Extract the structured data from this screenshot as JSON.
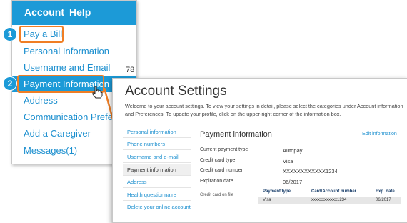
{
  "menu": {
    "bar": {
      "account_label": "Account",
      "help_label": "Help"
    },
    "items": [
      {
        "label": "Pay a Bill"
      },
      {
        "label": "Personal Information"
      },
      {
        "label": "Username and Email"
      },
      {
        "label": "Payment Information"
      },
      {
        "label": "Address"
      },
      {
        "label": "Communication Preferences"
      },
      {
        "label": "Add a Caregiver"
      },
      {
        "label": "Messages(1)"
      }
    ],
    "behind_text": {
      "number": "78"
    }
  },
  "steps": [
    {
      "number": "1"
    },
    {
      "number": "2"
    }
  ],
  "settings": {
    "title": "Account Settings",
    "description": "Welcome to your account settings. To view your settings in detail, please select the categories under Account information and Preferences. To update your profile, click on the upper-right corner of the information box.",
    "nav": [
      {
        "label": "Personal information"
      },
      {
        "label": "Phone numbers"
      },
      {
        "label": "Username and e-mail"
      },
      {
        "label": "Payment information"
      },
      {
        "label": "Address"
      },
      {
        "label": "Health questionnaire"
      },
      {
        "label": "Delete your online account"
      }
    ],
    "pane": {
      "title": "Payment information",
      "edit_label": "Edit information",
      "fields": [
        {
          "label": "Current payment type",
          "value": "Autopay"
        },
        {
          "label": "Credit card type",
          "value": "Visa"
        },
        {
          "label": "Credit card number",
          "value": "XXXXXXXXXXXX1234"
        },
        {
          "label": "Expiration date",
          "value": "06/2017"
        }
      ],
      "card_on_file_label": "Credit card on file",
      "table": {
        "headers": [
          "Payment type",
          "Card/Account number",
          "Exp. date"
        ],
        "rows": [
          [
            "Visa",
            "xxxxxxxxxxxx1234",
            "06/2017"
          ]
        ]
      }
    }
  },
  "colors": {
    "accent": "#1c9ad7",
    "callout": "#f07e24",
    "link": "#1b8fcf"
  }
}
